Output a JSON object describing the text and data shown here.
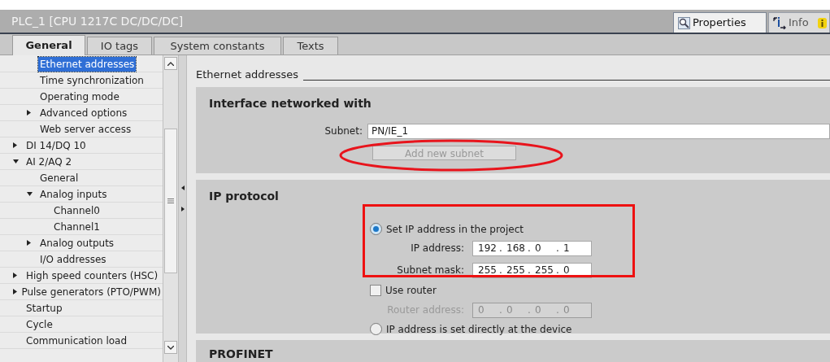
{
  "window": {
    "title": "PLC_1 [CPU 1217C DC/DC/DC]"
  },
  "view_tabs": [
    {
      "label": "Properties",
      "selected": true
    },
    {
      "label": "Info",
      "selected": false
    }
  ],
  "tabs": [
    {
      "label": "General",
      "selected": true
    },
    {
      "label": "IO tags",
      "selected": false
    },
    {
      "label": "System constants",
      "selected": false
    },
    {
      "label": "Texts",
      "selected": false
    }
  ],
  "tree": [
    {
      "children": [
        {
          "label": "Ethernet addresses",
          "selected": true
        },
        {
          "label": "Time synchronization",
          "selected": false
        },
        {
          "label": "Operating mode",
          "selected": false
        },
        {
          "label": "Advanced options",
          "selected": false,
          "expanded": false
        },
        {
          "label": "Web server access",
          "selected": false
        }
      ]
    },
    {
      "label": "DI 14/DQ 10",
      "selected": false,
      "expanded": false
    },
    {
      "label": "AI 2/AQ 2",
      "selected": false,
      "expanded": true,
      "children": [
        {
          "label": "General",
          "selected": false
        },
        {
          "label": "Analog inputs",
          "selected": false,
          "expanded": true,
          "children": [
            {
              "label": "Channel0",
              "selected": false
            },
            {
              "label": "Channel1",
              "selected": false
            }
          ]
        },
        {
          "label": "Analog outputs",
          "selected": false,
          "expanded": false
        },
        {
          "label": "I/O addresses",
          "selected": false
        }
      ]
    },
    {
      "label": "High speed counters (HSC)",
      "selected": false,
      "expanded": false
    },
    {
      "label": "Pulse generators (PTO/PWM)",
      "selected": false,
      "expanded": false
    },
    {
      "label": "Startup",
      "selected": false
    },
    {
      "label": "Cycle",
      "selected": false
    },
    {
      "label": "Communication load",
      "selected": false
    }
  ],
  "panel": {
    "heading": "Ethernet addresses",
    "interface": {
      "title": "Interface networked with",
      "subnet_label": "Subnet:",
      "subnet_value": "PN/IE_1",
      "add_button": {
        "label": "Add new subnet",
        "disabled": true
      },
      "highlight": {
        "kind": "ellipse"
      }
    },
    "ip_protocol": {
      "title": "IP protocol",
      "highlight": {
        "kind": "rectangle"
      },
      "set_in_project": {
        "label": "Set IP address in the project",
        "selected": true
      },
      "ip_address": {
        "label": "IP address:",
        "octets": [
          "192",
          "168",
          "0",
          "1"
        ],
        "separator": ".",
        "disabled": false
      },
      "subnet_mask": {
        "label": "Subnet mask:",
        "octets": [
          "255",
          "255",
          "255",
          "0"
        ],
        "separator": ".",
        "disabled": false
      },
      "use_router": {
        "label": "Use router",
        "checked": false
      },
      "router_address": {
        "label": "Router address:",
        "octets": [
          "0",
          "0",
          "0",
          "0"
        ],
        "separator": ".",
        "disabled": true
      },
      "set_at_device": {
        "label": "IP address is set directly at the device",
        "selected": false
      }
    },
    "next_section": {
      "title": "PROFINET"
    }
  }
}
